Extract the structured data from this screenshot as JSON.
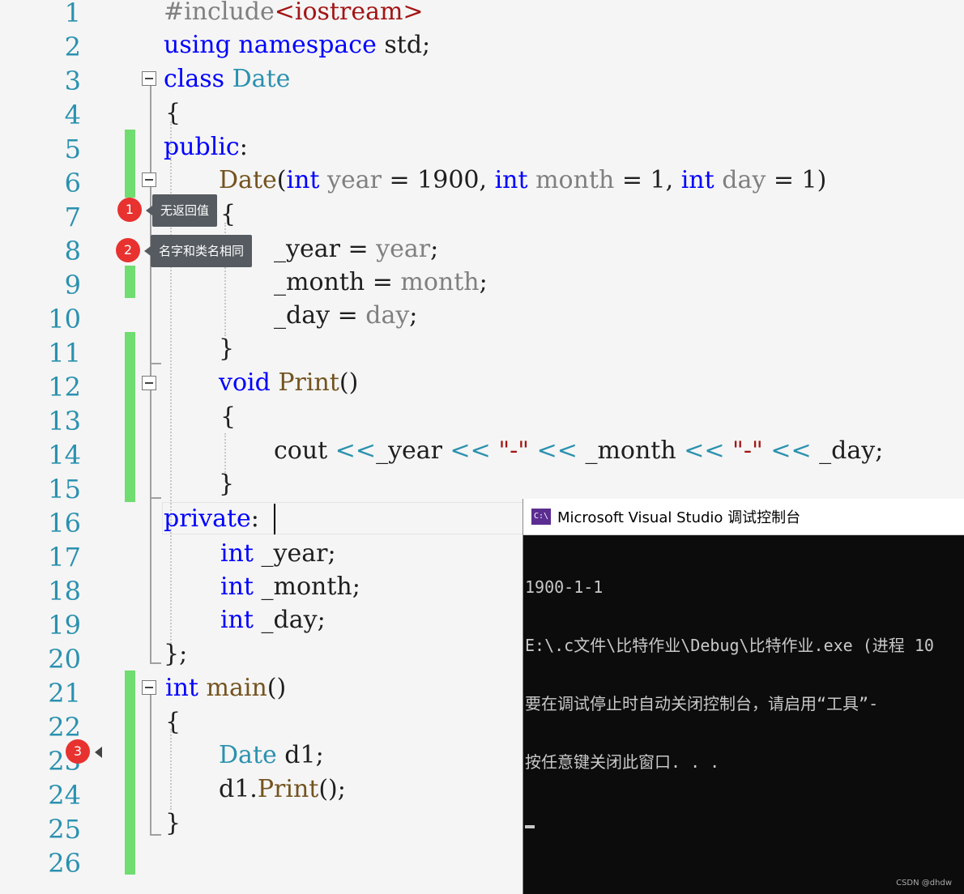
{
  "editor": {
    "line_numbers": [
      "1",
      "2",
      "3",
      "4",
      "5",
      "6",
      "7",
      "8",
      "9",
      "10",
      "11",
      "12",
      "13",
      "14",
      "15",
      "16",
      "17",
      "18",
      "19",
      "20",
      "21",
      "22",
      "23",
      "24",
      "25",
      "26"
    ],
    "code": {
      "l1_a": "#include",
      "l1_b": "<iostream>",
      "l2_a": "using",
      "l2_b": "namespace",
      "l2_c": "std;",
      "l3_a": "class",
      "l3_b": "Date",
      "l4": "{",
      "l5_a": "public",
      "l5_b": ":",
      "l6_a": "Date",
      "l6_b": "(",
      "l6_c": "int",
      "l6_d": "year",
      "l6_e": " = 1900, ",
      "l6_f": "int",
      "l6_g": "month",
      "l6_h": " = 1, ",
      "l6_i": "int",
      "l6_j": "day",
      "l6_k": " = 1)",
      "l7": "{",
      "l8_a": "_year = ",
      "l8_b": "year",
      "l8_c": ";",
      "l9_a": "_month = ",
      "l9_b": "month",
      "l9_c": ";",
      "l10_a": "_day = ",
      "l10_b": "day",
      "l10_c": ";",
      "l11": "}",
      "l12_a": "void",
      "l12_b": "Print",
      "l12_c": "()",
      "l13": "{",
      "l14_a": "cout ",
      "l14_b": "<<",
      "l14_c": "_year ",
      "l14_d": "<<",
      "l14_e": "\"-\"",
      "l14_f": "<<",
      "l14_g": "_month ",
      "l14_h": "<<",
      "l14_i": "\"-\"",
      "l14_j": "<<",
      "l14_k": "_day;",
      "l15": "}",
      "l16_a": "private",
      "l16_b": ":",
      "l17_a": "int",
      "l17_b": "_year;",
      "l18_a": "int",
      "l18_b": "_month;",
      "l19_a": "int",
      "l19_b": "_day;",
      "l20": "};",
      "l21_a": "int",
      "l21_b": "main",
      "l21_c": "()",
      "l22": "{",
      "l23_a": "Date",
      "l23_b": "d1;",
      "l24_a": "d1.",
      "l24_b": "Print",
      "l24_c": "();",
      "l25": "}"
    }
  },
  "annotations": {
    "badge1": "1",
    "tip1": "无返回值",
    "badge2": "2",
    "tip2": "名字和类名相同",
    "badge3": "3"
  },
  "console": {
    "title": "Microsoft Visual Studio 调试控制台",
    "icon_text": "C:\\",
    "lines": [
      "1900-1-1",
      "E:\\.c文件\\比特作业\\Debug\\比特作业.exe (进程 10",
      "要在调试停止时自动关闭控制台，请启用“工具”-",
      "按任意键关闭此窗口. . ."
    ],
    "watermark": "CSDN @dhdw"
  }
}
